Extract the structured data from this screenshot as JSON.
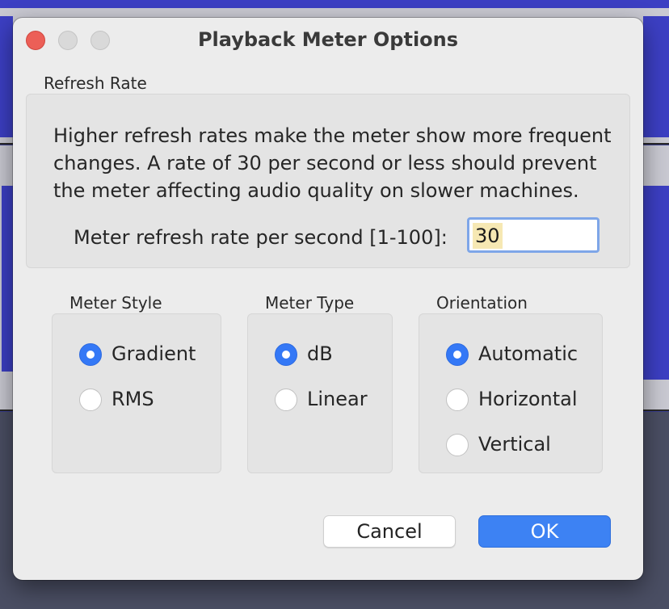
{
  "dialog": {
    "title": "Playback Meter Options",
    "window_controls": [
      "close",
      "minimize",
      "zoom"
    ]
  },
  "refresh_rate": {
    "section_label": "Refresh Rate",
    "description_lines": [
      "Higher refresh rates make the meter show more frequent",
      "changes. A rate of 30 per second or less should prevent",
      "the meter affecting audio quality on slower machines."
    ],
    "input_label": "Meter refresh rate per second [1-100]:",
    "input_value": "30"
  },
  "meter_style": {
    "label": "Meter Style",
    "options": [
      {
        "label": "Gradient",
        "selected": true
      },
      {
        "label": "RMS",
        "selected": false
      }
    ]
  },
  "meter_type": {
    "label": "Meter Type",
    "options": [
      {
        "label": "dB",
        "selected": true
      },
      {
        "label": "Linear",
        "selected": false
      }
    ]
  },
  "orientation": {
    "label": "Orientation",
    "options": [
      {
        "label": "Automatic",
        "selected": true
      },
      {
        "label": "Horizontal",
        "selected": false
      },
      {
        "label": "Vertical",
        "selected": false
      }
    ]
  },
  "buttons": {
    "cancel": "Cancel",
    "ok": "OK"
  },
  "colors": {
    "accent": "#3478f6",
    "ok_button": "#3d82f3",
    "close_button": "#ec5f57",
    "waveform": "#3c3fc3"
  }
}
